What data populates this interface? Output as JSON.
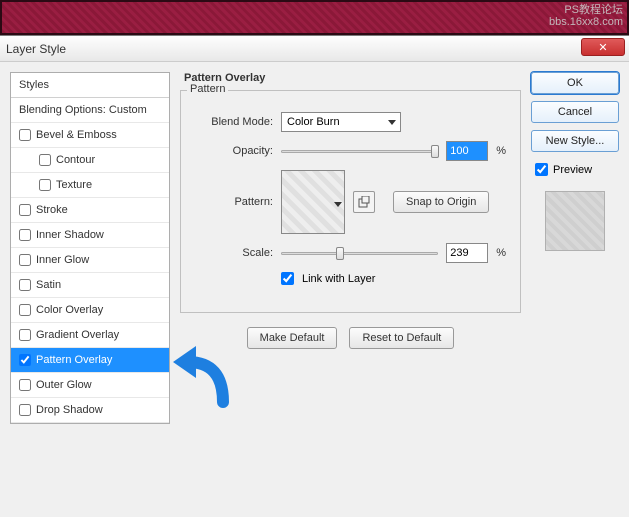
{
  "watermark": {
    "line1": "PS教程论坛",
    "line2": "bbs.16xx8.com"
  },
  "dialog": {
    "title": "Layer Style",
    "close": "✕"
  },
  "styles": {
    "header": "Styles",
    "blending": "Blending Options: Custom",
    "items": [
      {
        "label": "Bevel & Emboss",
        "checked": false,
        "indent": false,
        "selected": false
      },
      {
        "label": "Contour",
        "checked": false,
        "indent": true,
        "selected": false
      },
      {
        "label": "Texture",
        "checked": false,
        "indent": true,
        "selected": false
      },
      {
        "label": "Stroke",
        "checked": false,
        "indent": false,
        "selected": false
      },
      {
        "label": "Inner Shadow",
        "checked": false,
        "indent": false,
        "selected": false
      },
      {
        "label": "Inner Glow",
        "checked": false,
        "indent": false,
        "selected": false
      },
      {
        "label": "Satin",
        "checked": false,
        "indent": false,
        "selected": false
      },
      {
        "label": "Color Overlay",
        "checked": false,
        "indent": false,
        "selected": false
      },
      {
        "label": "Gradient Overlay",
        "checked": false,
        "indent": false,
        "selected": false
      },
      {
        "label": "Pattern Overlay",
        "checked": true,
        "indent": false,
        "selected": true
      },
      {
        "label": "Outer Glow",
        "checked": false,
        "indent": false,
        "selected": false
      },
      {
        "label": "Drop Shadow",
        "checked": false,
        "indent": false,
        "selected": false
      }
    ]
  },
  "panel": {
    "section_title": "Pattern Overlay",
    "group_title": "Pattern",
    "blend_mode_label": "Blend Mode:",
    "blend_mode_value": "Color Burn",
    "opacity_label": "Opacity:",
    "opacity_value": "100",
    "pattern_label": "Pattern:",
    "snap_button": "Snap to Origin",
    "scale_label": "Scale:",
    "scale_value": "239",
    "percent": "%",
    "link_label": "Link with Layer",
    "link_checked": true,
    "make_default": "Make Default",
    "reset_default": "Reset to Default"
  },
  "right": {
    "ok": "OK",
    "cancel": "Cancel",
    "new_style": "New Style...",
    "preview": "Preview",
    "preview_checked": true
  }
}
